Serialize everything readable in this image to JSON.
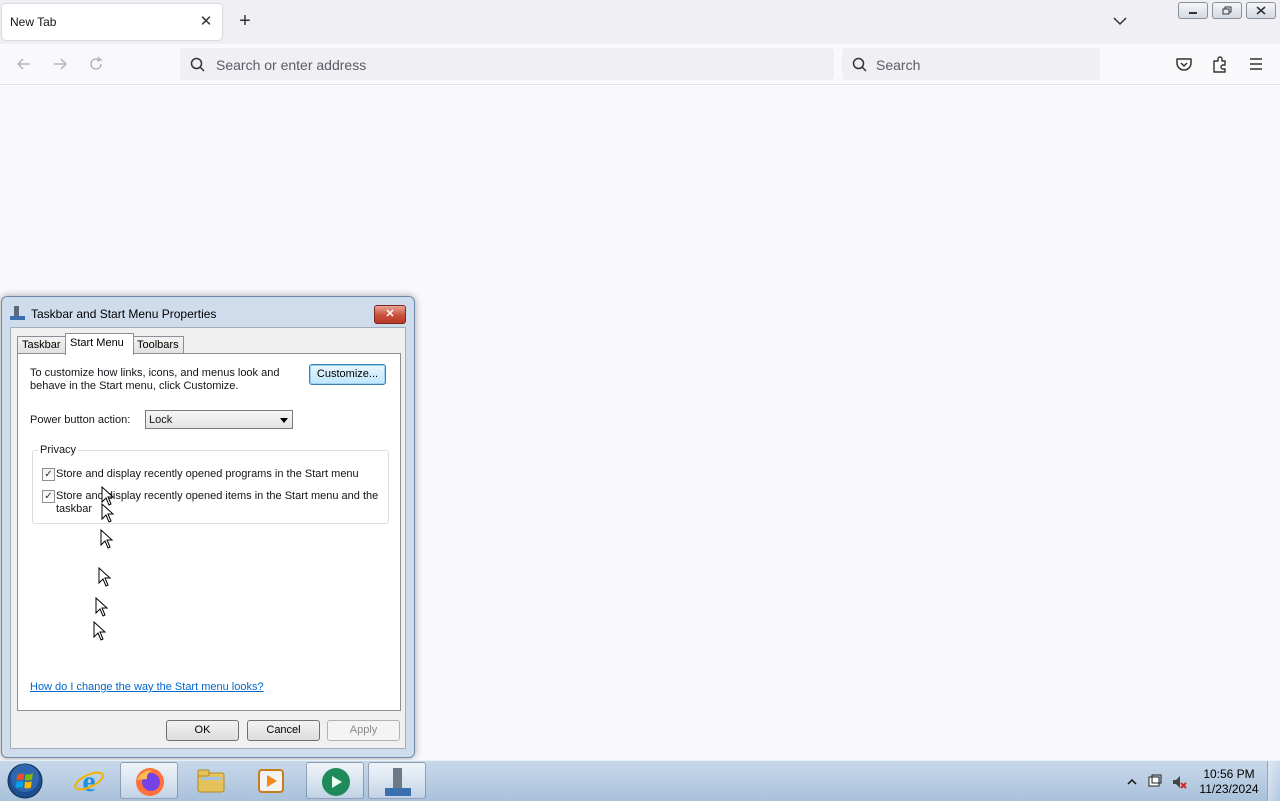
{
  "browser": {
    "tab_title": "New Tab",
    "url_placeholder": "Search or enter address",
    "search_placeholder": "Search"
  },
  "dialog": {
    "title": "Taskbar and Start Menu Properties",
    "tabs": [
      {
        "label": "Taskbar",
        "active": false
      },
      {
        "label": "Start Menu",
        "active": true
      },
      {
        "label": "Toolbars",
        "active": false
      }
    ],
    "description": "To customize how links, icons, and menus look and behave in the Start menu, click Customize.",
    "customize_label": "Customize...",
    "power_button_label": "Power button action:",
    "power_button_value": "Lock",
    "privacy_label": "Privacy",
    "checkbox_programs": {
      "label": "Store and display recently opened programs in the Start menu",
      "checked": true
    },
    "checkbox_items": {
      "label": "Store and display recently opened items in the Start menu and the taskbar",
      "checked": true
    },
    "help_link": "How do I change the way the Start menu looks?",
    "ok_label": "OK",
    "cancel_label": "Cancel",
    "apply_label": "Apply"
  },
  "taskbar": {
    "apps": [
      "start-orb",
      "internet-explorer-icon",
      "firefox-icon",
      "file-explorer-icon",
      "media-player-icon",
      "media-center-icon",
      "taskbar-properties-icon"
    ],
    "clock_time": "10:56 PM",
    "clock_date": "11/23/2024"
  }
}
